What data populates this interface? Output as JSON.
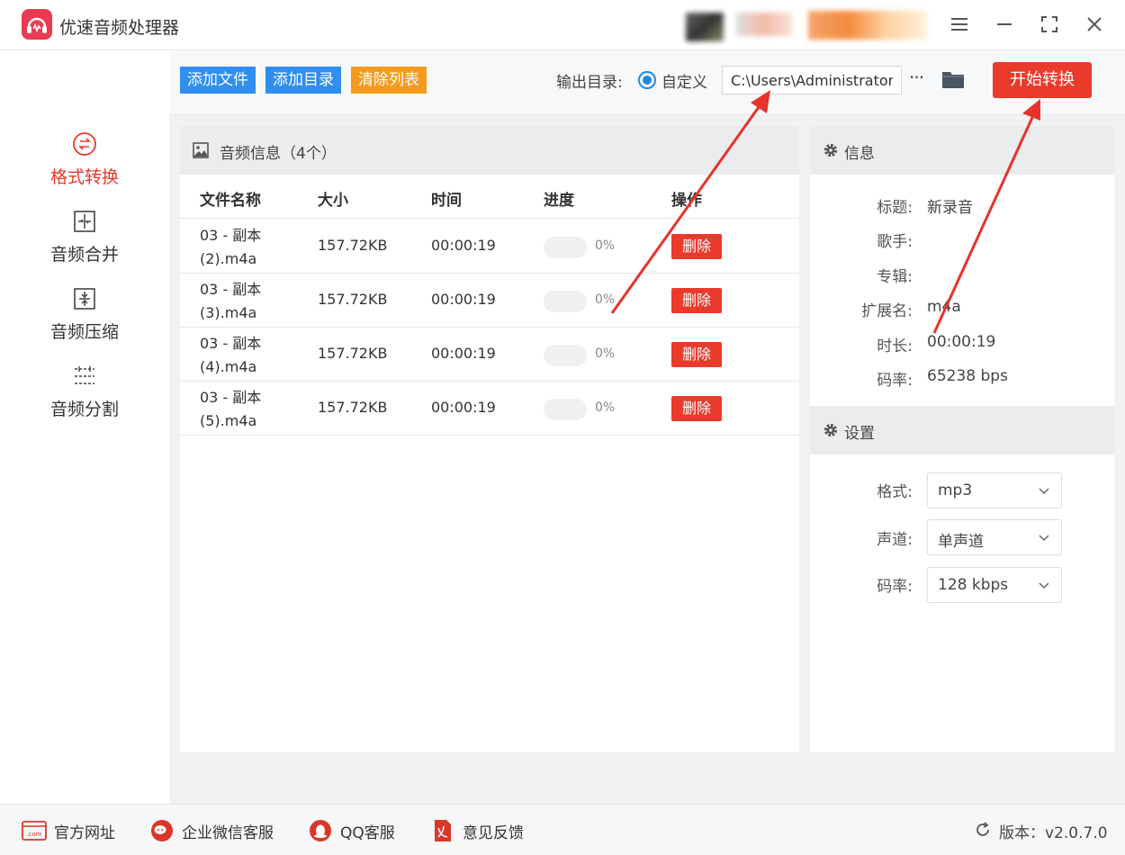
{
  "app": {
    "title": "优速音频处理器"
  },
  "sidebar": {
    "items": [
      {
        "label": "格式转换",
        "icon": "convert-icon",
        "active": true
      },
      {
        "label": "音频合并",
        "icon": "merge-icon",
        "active": false
      },
      {
        "label": "音频压缩",
        "icon": "compress-icon",
        "active": false
      },
      {
        "label": "音频分割",
        "icon": "split-icon",
        "active": false
      }
    ]
  },
  "toolbar": {
    "add_file": "添加文件",
    "add_dir": "添加目录",
    "clear_list": "清除列表",
    "output_label": "输出目录:",
    "radio_label": "自定义",
    "output_path": "C:\\Users\\Administrator\\",
    "more": "···",
    "start": "开始转换"
  },
  "list": {
    "title": "音频信息（4个）",
    "columns": [
      "文件名称",
      "大小",
      "时间",
      "进度",
      "操作"
    ],
    "rows": [
      {
        "name_line1": "03 - 副本",
        "name_line2": "(2).m4a",
        "size": "157.72KB",
        "time": "00:00:19",
        "progress": "0%",
        "action": "删除"
      },
      {
        "name_line1": "03 - 副本",
        "name_line2": "(3).m4a",
        "size": "157.72KB",
        "time": "00:00:19",
        "progress": "0%",
        "action": "删除"
      },
      {
        "name_line1": "03 - 副本",
        "name_line2": "(4).m4a",
        "size": "157.72KB",
        "time": "00:00:19",
        "progress": "0%",
        "action": "删除"
      },
      {
        "name_line1": "03 - 副本",
        "name_line2": "(5).m4a",
        "size": "157.72KB",
        "time": "00:00:19",
        "progress": "0%",
        "action": "删除"
      }
    ]
  },
  "info": {
    "title": "信息",
    "fields": [
      {
        "label": "标题:",
        "value": "新录音"
      },
      {
        "label": "歌手:",
        "value": ""
      },
      {
        "label": "专辑:",
        "value": ""
      },
      {
        "label": "扩展名:",
        "value": "m4a"
      },
      {
        "label": "时长:",
        "value": "00:00:19"
      },
      {
        "label": "码率:",
        "value": "65238 bps"
      }
    ]
  },
  "settings": {
    "title": "设置",
    "fields": [
      {
        "label": "格式:",
        "value": "mp3"
      },
      {
        "label": "声道:",
        "value": "单声道"
      },
      {
        "label": "码率:",
        "value": "128 kbps"
      }
    ]
  },
  "footer": {
    "website": "官方网址",
    "wechat": "企业微信客服",
    "qq": "QQ客服",
    "feedback": "意见反馈",
    "version": "版本：v2.0.7.0"
  },
  "colors": {
    "accent_red": "#ea3a2b",
    "button_blue": "#2f8ef0",
    "button_orange": "#f59a1c"
  }
}
